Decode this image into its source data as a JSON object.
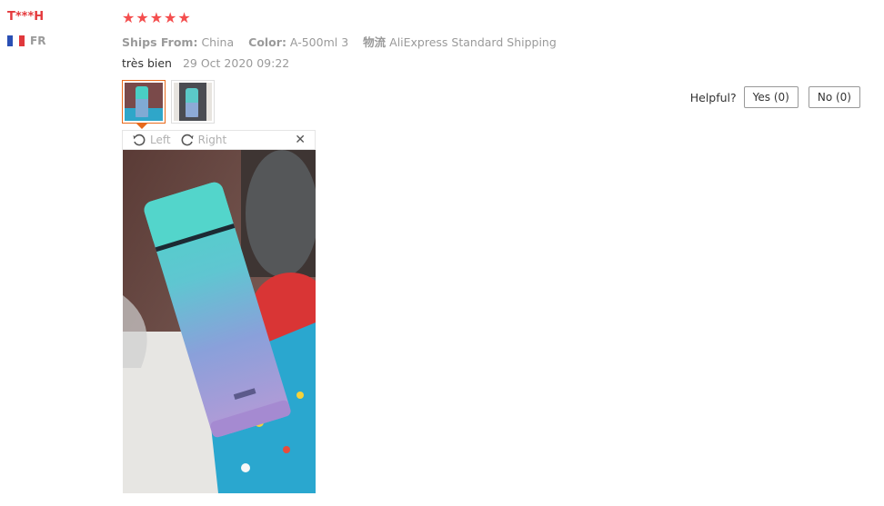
{
  "reviewer": {
    "name": "T***H",
    "country": "FR"
  },
  "rating": {
    "stars": 5,
    "max": 5,
    "color": "#f44e4e"
  },
  "meta": {
    "ships_from_label": "Ships From:",
    "ships_from_value": "China",
    "color_label": "Color:",
    "color_value": "A-500ml 3",
    "logistics_label": "物流",
    "logistics_value": "AliExpress Standard Shipping"
  },
  "review": {
    "text": "très bien",
    "date": "29 Oct 2020 09:22"
  },
  "thumbnails": [
    {
      "name": "review-photo-1",
      "selected": true
    },
    {
      "name": "review-photo-2",
      "selected": false
    }
  ],
  "viewer": {
    "rotate_left_label": "Left",
    "rotate_right_label": "Right",
    "close_symbol": "✕"
  },
  "helpful": {
    "label": "Helpful?",
    "yes_label": "Yes (0)",
    "no_label": "No (0)"
  },
  "colors": {
    "accent_red": "#e4393c",
    "selected_border": "#e86a1c"
  }
}
